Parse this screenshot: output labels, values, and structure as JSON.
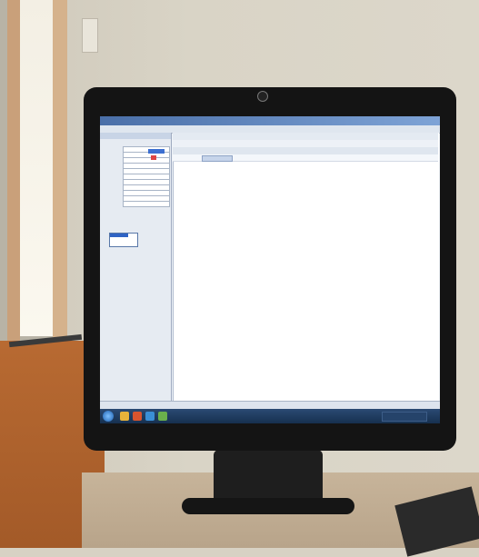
{
  "scene": {
    "description_colors": {
      "monitor": "#141414",
      "screen": "#eef2f7",
      "wall": "#d9d4c6",
      "cabinet": "#a35a28",
      "desk": "#c7b49a",
      "titlebar": "#4a6fa8",
      "taskbar": "#16304f"
    }
  },
  "monitor": {
    "brand_label": "",
    "keyboard_label": ""
  },
  "app": {
    "title": "",
    "menubar": "",
    "left_header": "",
    "left_rows": [
      "",
      "",
      "",
      "",
      "",
      "",
      "",
      "",
      "",
      "",
      "",
      "",
      "",
      "",
      "",
      "",
      ""
    ],
    "main_toolbar1": "",
    "main_toolbar2": "",
    "main_col_headers": [
      "",
      "",
      "",
      "",
      ""
    ],
    "main_row1": [
      "",
      ""
    ],
    "status_text": "",
    "clock": ""
  }
}
